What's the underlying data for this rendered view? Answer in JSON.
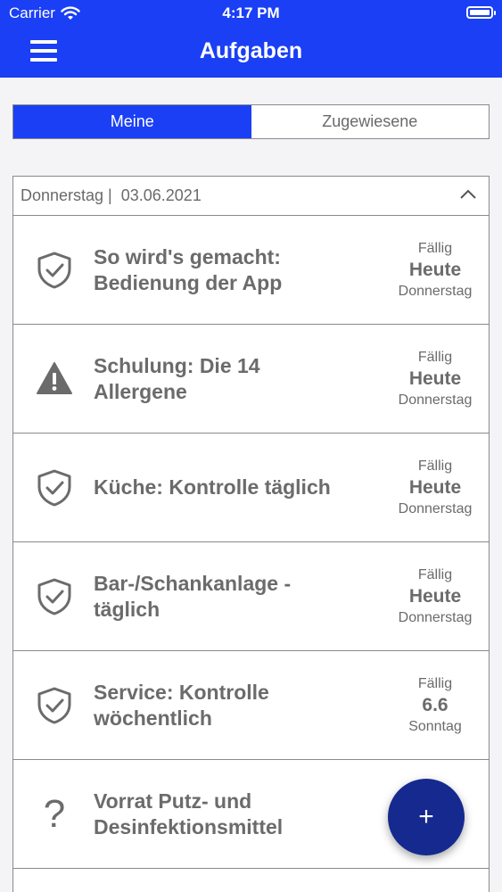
{
  "status_bar": {
    "carrier": "Carrier",
    "time": "4:17 PM"
  },
  "header": {
    "title": "Aufgaben"
  },
  "tabs": [
    {
      "label": "Meine",
      "active": true
    },
    {
      "label": "Zugewiesene",
      "active": false
    }
  ],
  "date_header": {
    "label": "Donnerstag |  03.06.2021"
  },
  "tasks": [
    {
      "icon": "shield-check-icon",
      "line1": "So wird's gemacht:",
      "line2": "Bedienung der App",
      "due_label": "Fällig",
      "due_value": "Heute",
      "due_day": "Donnerstag"
    },
    {
      "icon": "warning-icon",
      "line1": "Schulung: Die 14",
      "line2": "Allergene",
      "due_label": "Fällig",
      "due_value": "Heute",
      "due_day": "Donnerstag"
    },
    {
      "icon": "shield-check-icon",
      "line1": "Küche: Kontrolle täglich",
      "line2": "",
      "due_label": "Fällig",
      "due_value": "Heute",
      "due_day": "Donnerstag"
    },
    {
      "icon": "shield-check-icon",
      "line1": "Bar-/Schankanlage -",
      "line2": "täglich",
      "due_label": "Fällig",
      "due_value": "Heute",
      "due_day": "Donnerstag"
    },
    {
      "icon": "shield-check-icon",
      "line1": "Service: Kontrolle",
      "line2": "wöchentlich",
      "due_label": "Fällig",
      "due_value": "6.6",
      "due_day": "Sonntag"
    },
    {
      "icon": "question-mark-icon",
      "line1": "Vorrat Putz- und",
      "line2": "Desinfektionsmittel",
      "due_label": "",
      "due_value": "",
      "due_day": ""
    }
  ],
  "fab": {
    "label": "+"
  },
  "colors": {
    "brand": "#1a3ff5",
    "fab": "#15298f",
    "text": "#6b6b6b"
  }
}
